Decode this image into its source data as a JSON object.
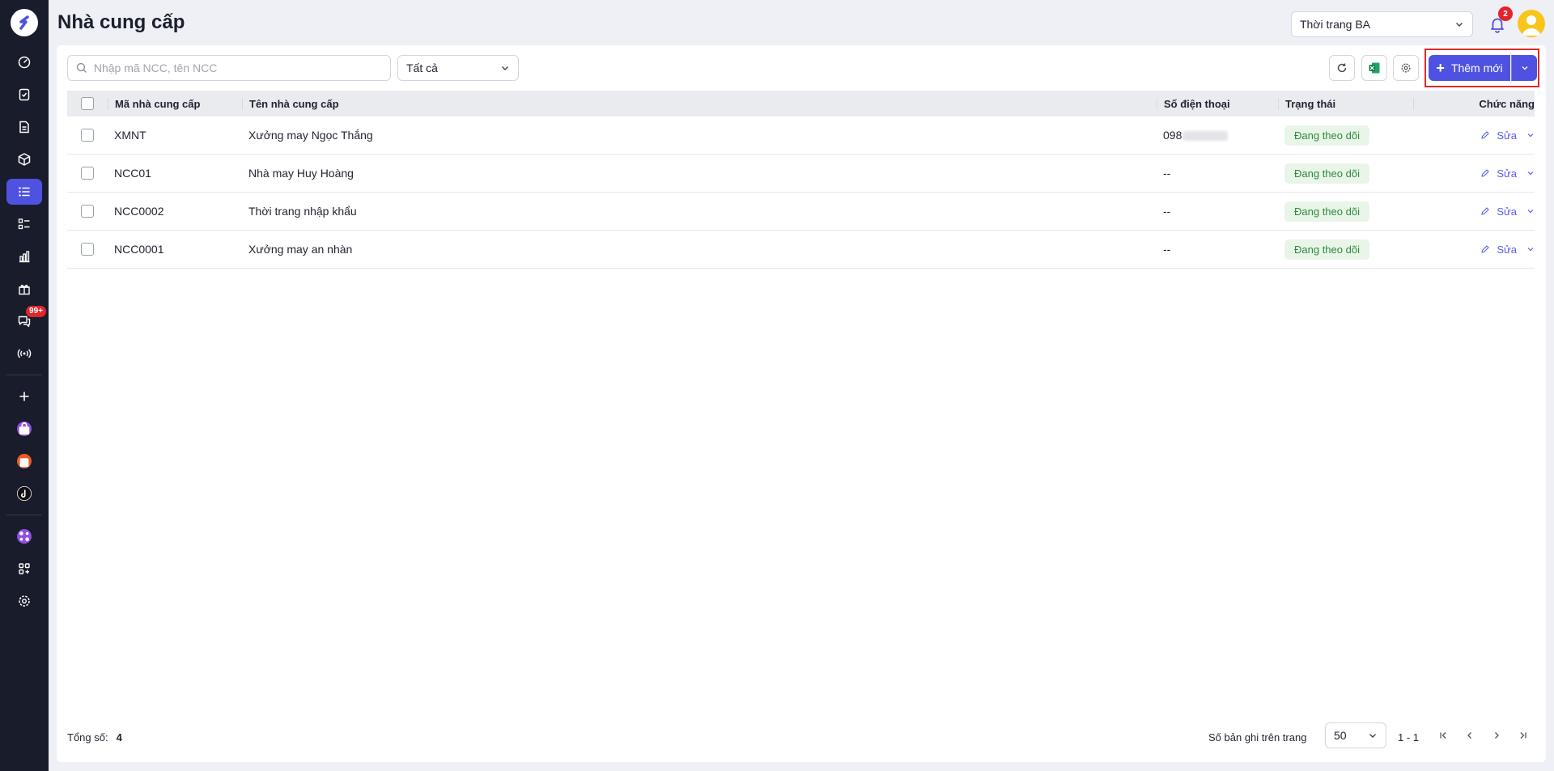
{
  "header": {
    "title": "Nhà cung cấp",
    "store_select": "Thời trang BA",
    "notification_count": "2"
  },
  "sidebar": {
    "chat_badge": "99+"
  },
  "toolbar": {
    "search_placeholder": "Nhập mã NCC, tên NCC",
    "filter_value": "Tất cả",
    "add_label": "Thêm mới"
  },
  "table": {
    "columns": {
      "code": "Mã nhà cung cấp",
      "name": "Tên nhà cung cấp",
      "phone": "Số điện thoại",
      "status": "Trạng thái",
      "actions": "Chức năng"
    },
    "edit_label": "Sửa",
    "rows": [
      {
        "code": "XMNT",
        "name": "Xưởng may Ngọc Thắng",
        "phone": "098",
        "status": "Đang theo dõi"
      },
      {
        "code": "NCC01",
        "name": "Nhà may Huy Hoàng",
        "phone": "--",
        "status": "Đang theo dõi"
      },
      {
        "code": "NCC0002",
        "name": "Thời trang nhập khẩu",
        "phone": "--",
        "status": "Đang theo dõi"
      },
      {
        "code": "NCC0001",
        "name": "Xưởng may an nhàn",
        "phone": "--",
        "status": "Đang theo dõi"
      }
    ]
  },
  "footer": {
    "total_label": "Tổng số:",
    "total_value": "4",
    "page_size_label": "Số bản ghi trên trang",
    "page_size": "50",
    "range": "1 - 1"
  },
  "colors": {
    "primary": "#4f52e0",
    "sidebar_bg": "#181c2b",
    "status_green": "#2f8a3b",
    "highlight_red": "#e02a2a"
  }
}
